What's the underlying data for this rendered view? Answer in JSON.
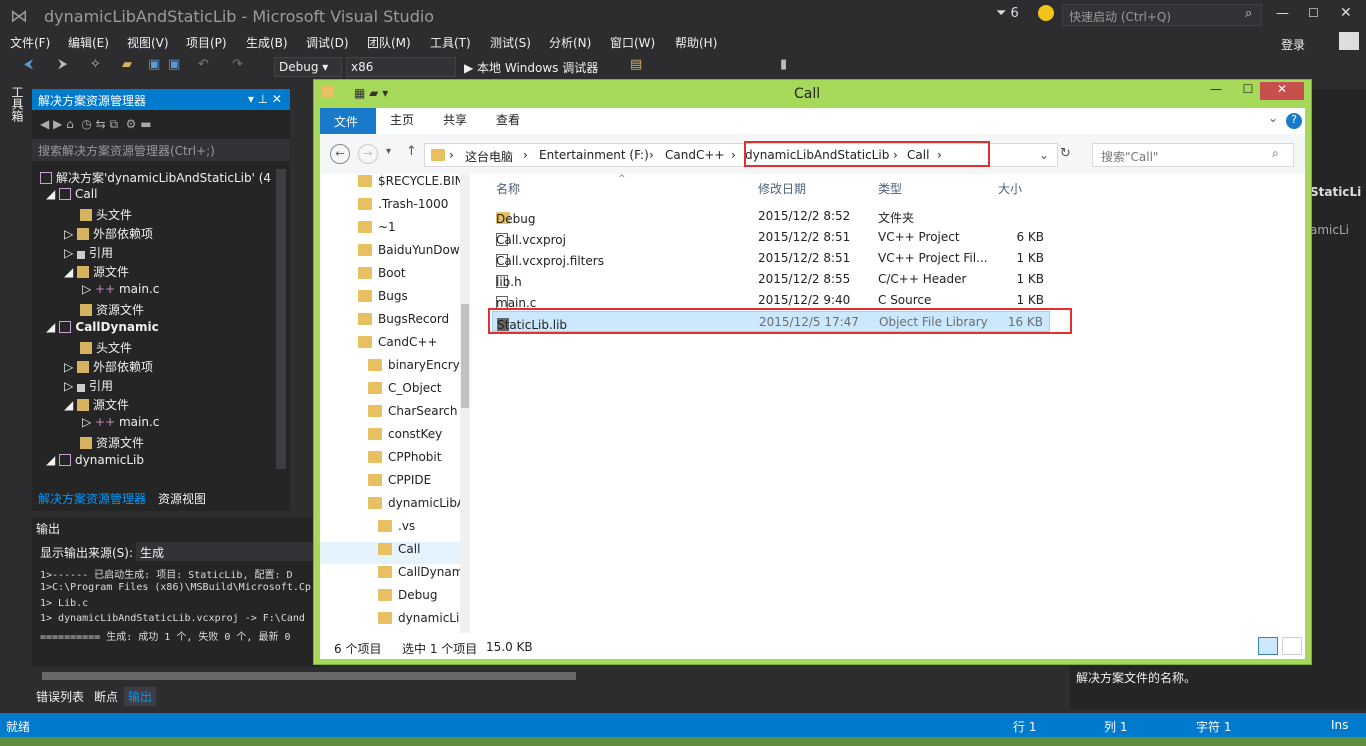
{
  "vs": {
    "title": "dynamicLibAndStaticLib - Microsoft Visual Studio",
    "notif_count": "6",
    "quick_launch": "快速启动 (Ctrl+Q)",
    "login": "登录",
    "menu": [
      "文件(F)",
      "编辑(E)",
      "视图(V)",
      "项目(P)",
      "生成(B)",
      "调试(D)",
      "团队(M)",
      "工具(T)",
      "测试(S)",
      "分析(N)",
      "窗口(W)",
      "帮助(H)"
    ],
    "config": "Debug",
    "platform": "x86",
    "run_label": "▶ 本地 Windows 调试器",
    "left_vertical_tab": "工具箱"
  },
  "solution_explorer": {
    "title": "解决方案资源管理器",
    "search_placeholder": "搜索解决方案资源管理器(Ctrl+;)",
    "solution": "解决方案'dynamicLibAndStaticLib' (4",
    "tree": [
      {
        "label": "Call",
        "level": 1,
        "bold": false
      },
      {
        "label": "头文件",
        "level": 2,
        "bold": false
      },
      {
        "label": "外部依赖项",
        "level": 2,
        "bold": false
      },
      {
        "label": "引用",
        "level": 2,
        "bold": false
      },
      {
        "label": "源文件",
        "level": 2,
        "bold": false
      },
      {
        "label": "main.c",
        "level": 3,
        "bold": false
      },
      {
        "label": "资源文件",
        "level": 2,
        "bold": false
      },
      {
        "label": "CallDynamic",
        "level": 1,
        "bold": true
      },
      {
        "label": "头文件",
        "level": 2,
        "bold": false
      },
      {
        "label": "外部依赖项",
        "level": 2,
        "bold": false
      },
      {
        "label": "引用",
        "level": 2,
        "bold": false
      },
      {
        "label": "源文件",
        "level": 2,
        "bold": false
      },
      {
        "label": "main.c",
        "level": 3,
        "bold": false
      },
      {
        "label": "资源文件",
        "level": 2,
        "bold": false
      },
      {
        "label": "dynamicLib",
        "level": 1,
        "bold": false
      }
    ],
    "tabs": [
      "解决方案资源管理器",
      "资源视图"
    ]
  },
  "output": {
    "title": "输出",
    "source_label": "显示输出来源(S):",
    "source_value": "生成",
    "lines": [
      "1>------ 已启动生成: 项目: StaticLib, 配置: D",
      "1>C:\\Program Files (x86)\\MSBuild\\Microsoft.Cp",
      "1>  Lib.c",
      "1>  dynamicLibAndStaticLib.vcxproj -> F:\\Cand",
      "========== 生成: 成功 1 个, 失败 0 个, 最新 0"
    ],
    "bottom_tabs": [
      "错误列表",
      "断点",
      "输出"
    ]
  },
  "status": {
    "ready": "就绪",
    "line": "行 1",
    "col": "列 1",
    "char": "字符 1",
    "ins": "Ins"
  },
  "right_desc": "解决方案文件的名称。",
  "explorer": {
    "title": "Call",
    "ribbon_tabs": [
      "文件",
      "主页",
      "共享",
      "查看"
    ],
    "breadcrumb": [
      "这台电脑",
      "Entertainment (F:)",
      "CandC++",
      "dynamicLibAndStaticLib",
      "Call"
    ],
    "search_placeholder": "搜索\"Call\"",
    "nav": [
      {
        "label": "$RECYCLE.BIN",
        "indent": 0
      },
      {
        "label": ".Trash-1000",
        "indent": 0
      },
      {
        "label": "~1",
        "indent": 0
      },
      {
        "label": "BaiduYunDownload",
        "indent": 0
      },
      {
        "label": "Boot",
        "indent": 0
      },
      {
        "label": "Bugs",
        "indent": 0
      },
      {
        "label": "BugsRecord",
        "indent": 0
      },
      {
        "label": "CandC++",
        "indent": 0
      },
      {
        "label": "binaryEncrypt",
        "indent": 1
      },
      {
        "label": "C_Object",
        "indent": 1
      },
      {
        "label": "CharSearch",
        "indent": 1
      },
      {
        "label": "constKey",
        "indent": 1
      },
      {
        "label": "CPPhobit",
        "indent": 1
      },
      {
        "label": "CPPIDE",
        "indent": 1
      },
      {
        "label": "dynamicLibAndStaticLib",
        "indent": 1
      },
      {
        "label": ".vs",
        "indent": 2
      },
      {
        "label": "Call",
        "indent": 2
      },
      {
        "label": "CallDynamic",
        "indent": 2
      },
      {
        "label": "Debug",
        "indent": 2
      },
      {
        "label": "dynamicLib",
        "indent": 2
      }
    ],
    "columns": [
      "名称",
      "修改日期",
      "类型",
      "大小"
    ],
    "files": [
      {
        "name": "Debug",
        "date": "2015/12/2 8:52",
        "type": "文件夹",
        "size": ""
      },
      {
        "name": "Call.vcxproj",
        "date": "2015/12/2 8:51",
        "type": "VC++ Project",
        "size": "6 KB"
      },
      {
        "name": "Call.vcxproj.filters",
        "date": "2015/12/2 8:51",
        "type": "VC++ Project Fil...",
        "size": "1 KB"
      },
      {
        "name": "lib.h",
        "date": "2015/12/2 8:55",
        "type": "C/C++ Header",
        "size": "1 KB"
      },
      {
        "name": "main.c",
        "date": "2015/12/2 9:40",
        "type": "C Source",
        "size": "1 KB"
      },
      {
        "name": "StaticLib.lib",
        "date": "2015/12/5 17:47",
        "type": "Object File Library",
        "size": "16 KB"
      }
    ],
    "status_count": "6 个项目",
    "status_selected": "选中 1 个项目",
    "status_size": "15.0 KB"
  }
}
